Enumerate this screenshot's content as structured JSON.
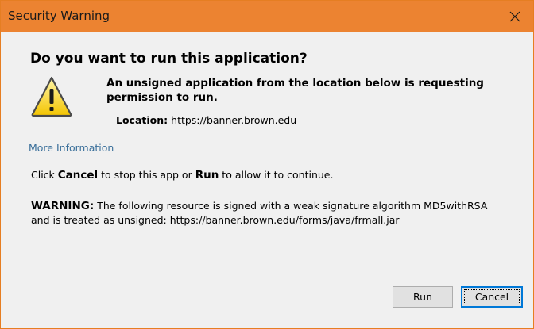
{
  "window": {
    "title": "Security Warning",
    "accent_color": "#ec8331",
    "close_icon": "close-icon"
  },
  "dialog": {
    "heading": "Do you want to run this application?",
    "icon": "warning-triangle-icon",
    "lead": "An unsigned application from the location below is requesting permission to run.",
    "location_label": "Location:",
    "location_value": "https://banner.brown.edu",
    "more_info_link": "More Information",
    "instruction": {
      "pre": "Click ",
      "cancel_word": "Cancel",
      "mid": " to stop this app or ",
      "run_word": "Run",
      "post": " to allow it to continue."
    },
    "warning": {
      "label": "WARNING:",
      "text": " The following resource is signed with a weak signature algorithm MD5withRSA and is treated as unsigned: https://banner.brown.edu/forms/java/frmall.jar"
    }
  },
  "buttons": {
    "run_label": "Run",
    "cancel_label": "Cancel"
  }
}
